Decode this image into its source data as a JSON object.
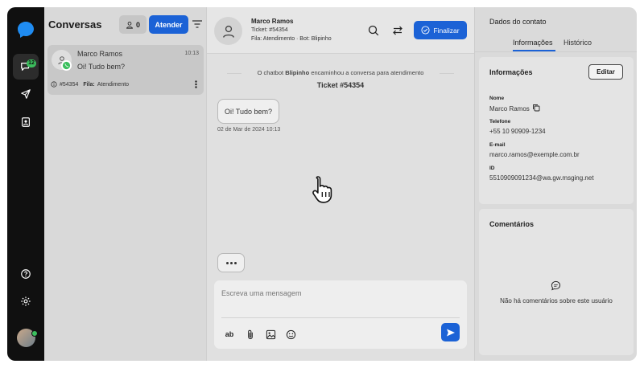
{
  "rail": {
    "badge_count": "12"
  },
  "conversations": {
    "title": "Conversas",
    "agents_count": "0",
    "attend_label": "Atender",
    "items": [
      {
        "name": "Marco Ramos",
        "time": "10:13",
        "message": "Oi! Tudo bem?",
        "ticket": "#54354",
        "queue_label": "Fila:",
        "queue": "Atendimento"
      }
    ]
  },
  "chat": {
    "contact_name": "Marco Ramos",
    "ticket_line": "Ticket: #54354",
    "queue_line": "Fila: Atendimento · Bot:  Blipinho",
    "finish_label": "Finalizar",
    "system_prefix": "O chatbot",
    "system_bot": "Blipinho",
    "system_suffix": "encaminhou a conversa para atendimento",
    "ticket_title": "Ticket #54354",
    "message_text": "Oi! Tudo bem?",
    "message_time": "02 de Mar de 2024 10:13",
    "composer_placeholder": "Escreva uma mensagem",
    "format_label": "ab"
  },
  "contact": {
    "title": "Dados do contato",
    "tabs": [
      "Informações",
      "Histórico"
    ],
    "info_title": "Informações",
    "edit_label": "Editar",
    "fields": [
      {
        "label": "Nome",
        "value": "Marco Ramos"
      },
      {
        "label": "Telefone",
        "value": "+55 10 90909-1234"
      },
      {
        "label": "E-mail",
        "value": "marco.ramos@exemple.com.br"
      },
      {
        "label": "ID",
        "value": "5510909091234@wa.gw.msging.net"
      }
    ],
    "comments_title": "Comentários",
    "comments_empty": "Não há comentários sobre este usuário"
  },
  "colors": {
    "accent": "#1b62d6",
    "rail": "#101010",
    "online": "#3cbf5e"
  },
  "icons": [
    "chat-bubble-logo-icon",
    "chats-icon",
    "send-nav-icon",
    "contacts-icon",
    "help-icon",
    "settings-icon",
    "user-icon",
    "filter-icon",
    "whatsapp-icon",
    "info-icon",
    "more-vertical-icon",
    "search-icon",
    "transfer-icon",
    "check-circle-icon",
    "attach-icon",
    "image-icon",
    "emoji-icon",
    "send-icon",
    "copy-icon",
    "comment-icon",
    "pointer-hand-icon"
  ]
}
